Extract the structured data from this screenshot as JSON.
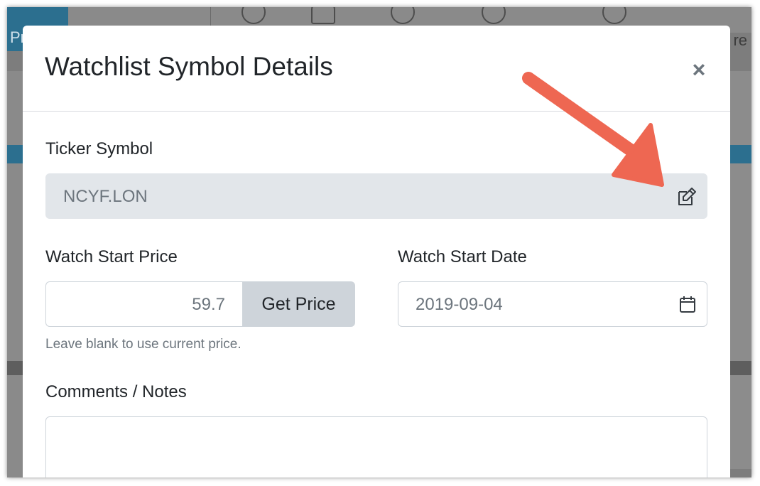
{
  "background": {
    "right_header_label": "re"
  },
  "modal": {
    "title": "Watchlist Symbol Details",
    "close_icon": "close-icon"
  },
  "form": {
    "ticker": {
      "label": "Ticker Symbol",
      "value": "NCYF.LON",
      "edit_icon": "edit-icon"
    },
    "start_price": {
      "label": "Watch Start Price",
      "value": "59.7",
      "button_label": "Get Price",
      "help_text": "Leave blank to use current price."
    },
    "start_date": {
      "label": "Watch Start Date",
      "value": "2019-09-04",
      "icon": "calendar-icon"
    },
    "comments": {
      "label": "Comments / Notes",
      "value": ""
    }
  },
  "colors": {
    "annotation_arrow": "#ee6752",
    "readonly_bg": "#e2e6ea",
    "button_bg": "#ced4da",
    "app_accent": "#2c6f8f"
  }
}
